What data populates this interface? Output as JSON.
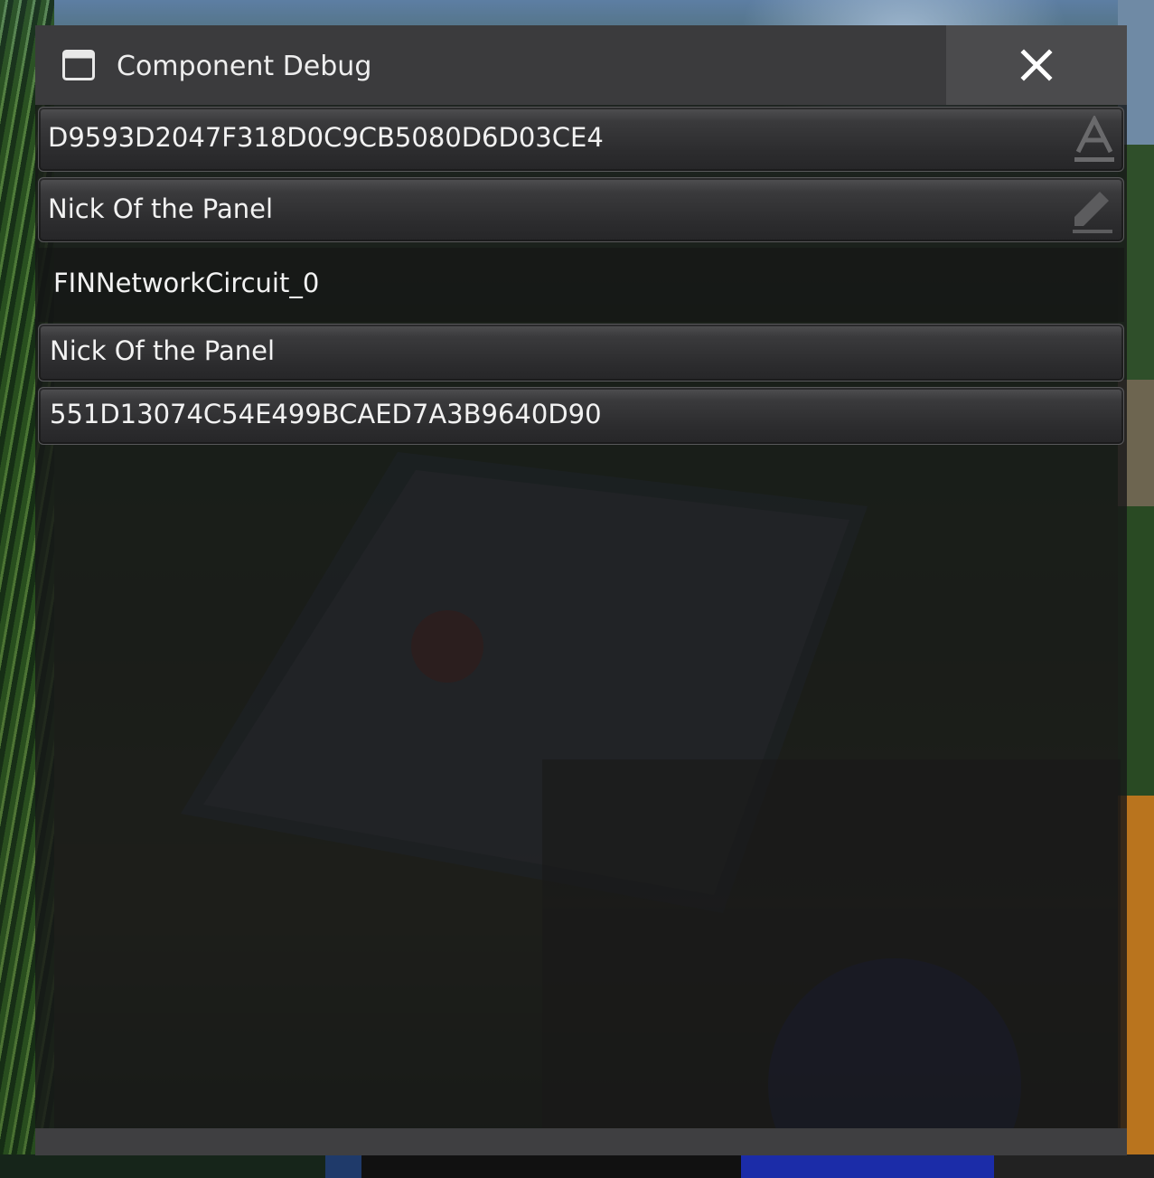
{
  "window": {
    "title": "Component Debug",
    "close_label": "close"
  },
  "fields": {
    "component_id": "D9593D2047F318D0C9CB5080D6D03CE4",
    "nick": "Nick Of the Panel",
    "circuit_name": "FINNetworkCircuit_0",
    "nick_display": "Nick Of the Panel",
    "network_id": "551D13074C54E499BCAED7A3B9640D90"
  },
  "icons": {
    "title": "window-icon",
    "close": "close-icon",
    "id_field": "text-format-icon",
    "nick_field": "pencil-icon"
  }
}
